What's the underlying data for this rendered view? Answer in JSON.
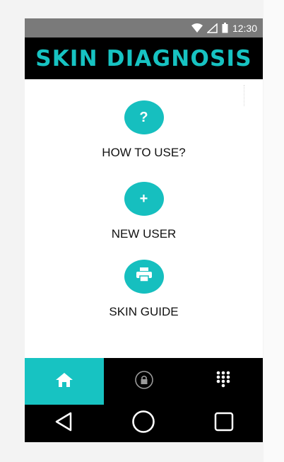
{
  "status_bar": {
    "time": "12:30",
    "icons": [
      "wifi-icon",
      "signal-icon",
      "battery-icon"
    ]
  },
  "app_bar": {
    "title": "SKIN DIAGNOSIS"
  },
  "menu": {
    "items": [
      {
        "label": "HOW TO USE?",
        "icon": "help-icon",
        "glyph": "?"
      },
      {
        "label": "NEW USER",
        "icon": "plus-icon",
        "glyph": "+"
      },
      {
        "label": "SKIN GUIDE",
        "icon": "printer-icon",
        "glyph": ""
      }
    ]
  },
  "bottom_nav": {
    "tabs": [
      {
        "icon": "home-icon",
        "active": true
      },
      {
        "icon": "lock-icon",
        "active": false
      },
      {
        "icon": "dialpad-icon",
        "active": false
      }
    ]
  },
  "system_nav": {
    "buttons": [
      "back-icon",
      "home-circle-icon",
      "recents-icon"
    ]
  },
  "colors": {
    "accent": "#17c3c2",
    "bar": "#000000",
    "status_bar": "#7a7a7a"
  }
}
